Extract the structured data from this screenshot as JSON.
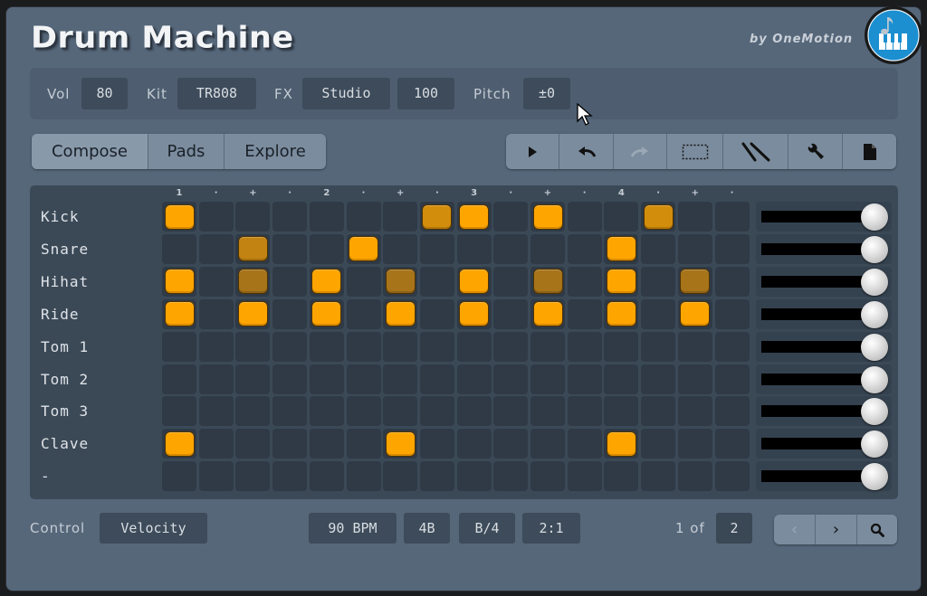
{
  "app": {
    "title": "Drum Machine",
    "byline": "by OneMotion",
    "logo_icon": "music-note-piano-icon"
  },
  "params": {
    "vol_label": "Vol",
    "vol_value": "80",
    "kit_label": "Kit",
    "kit_value": "TR808",
    "fx_label": "FX",
    "fx_value": "Studio",
    "fx_amount": "100",
    "pitch_label": "Pitch",
    "pitch_value": "±0"
  },
  "tabs": [
    {
      "label": "Compose",
      "active": true
    },
    {
      "label": "Pads",
      "active": false
    },
    {
      "label": "Explore",
      "active": false
    }
  ],
  "toolbar": [
    {
      "name": "play-button",
      "icon": "play-icon",
      "enabled": true
    },
    {
      "name": "undo-button",
      "icon": "undo-icon",
      "enabled": true
    },
    {
      "name": "redo-button",
      "icon": "redo-icon",
      "enabled": false
    },
    {
      "name": "select-button",
      "icon": "selection-rect-icon",
      "enabled": true
    },
    {
      "name": "drumsticks-button",
      "icon": "drumsticks-icon",
      "enabled": true
    },
    {
      "name": "settings-button",
      "icon": "wrench-icon",
      "enabled": true
    },
    {
      "name": "file-button",
      "icon": "file-icon",
      "enabled": true
    }
  ],
  "sequencer": {
    "beat_labels": [
      "1",
      "·",
      "+",
      "·",
      "2",
      "·",
      "+",
      "·",
      "3",
      "·",
      "+",
      "·",
      "4",
      "·",
      "+",
      "·"
    ],
    "pad_colors": {
      "on": "#ffa500",
      "empty": "#2f3a46"
    },
    "rows": [
      {
        "name": "Kick",
        "volume": 1.0,
        "steps": [
          1,
          0,
          0,
          0,
          0,
          0,
          0,
          0.75,
          1,
          0,
          1,
          0,
          0,
          0.75,
          0,
          0
        ]
      },
      {
        "name": "Snare",
        "volume": 1.0,
        "steps": [
          0,
          0,
          0.65,
          0,
          0,
          1,
          0,
          0,
          0,
          0,
          0,
          0,
          1,
          0,
          0,
          0
        ]
      },
      {
        "name": "Hihat",
        "volume": 1.0,
        "steps": [
          1,
          0,
          0.5,
          0,
          1,
          0,
          0.5,
          0,
          1,
          0,
          0.5,
          0,
          1,
          0,
          0.5,
          0
        ]
      },
      {
        "name": "Ride",
        "volume": 1.0,
        "steps": [
          1,
          0,
          1,
          0,
          1,
          0,
          1,
          0,
          1,
          0,
          1,
          0,
          1,
          0,
          1,
          0
        ]
      },
      {
        "name": "Tom 1",
        "volume": 1.0,
        "steps": [
          0,
          0,
          0,
          0,
          0,
          0,
          0,
          0,
          0,
          0,
          0,
          0,
          0,
          0,
          0,
          0
        ]
      },
      {
        "name": "Tom 2",
        "volume": 1.0,
        "steps": [
          0,
          0,
          0,
          0,
          0,
          0,
          0,
          0,
          0,
          0,
          0,
          0,
          0,
          0,
          0,
          0
        ]
      },
      {
        "name": "Tom 3",
        "volume": 1.0,
        "steps": [
          0,
          0,
          0,
          0,
          0,
          0,
          0,
          0,
          0,
          0,
          0,
          0,
          0,
          0,
          0,
          0
        ]
      },
      {
        "name": "Clave",
        "volume": 1.0,
        "steps": [
          1,
          0,
          0,
          0,
          0,
          0,
          1,
          0,
          0,
          0,
          0,
          0,
          1,
          0,
          0,
          0
        ]
      },
      {
        "name": "-",
        "volume": 1.0,
        "steps": [
          0,
          0,
          0,
          0,
          0,
          0,
          0,
          0,
          0,
          0,
          0,
          0,
          0,
          0,
          0,
          0
        ]
      }
    ]
  },
  "footer": {
    "control_label": "Control",
    "control_value": "Velocity",
    "bpm": "90 BPM",
    "beats": "4B",
    "signature": "B/4",
    "swing": "2:1",
    "page_label": "1 of",
    "page_total": "2",
    "prev_label": "‹",
    "next_label": "›",
    "zoom_icon": "magnifier-icon"
  }
}
